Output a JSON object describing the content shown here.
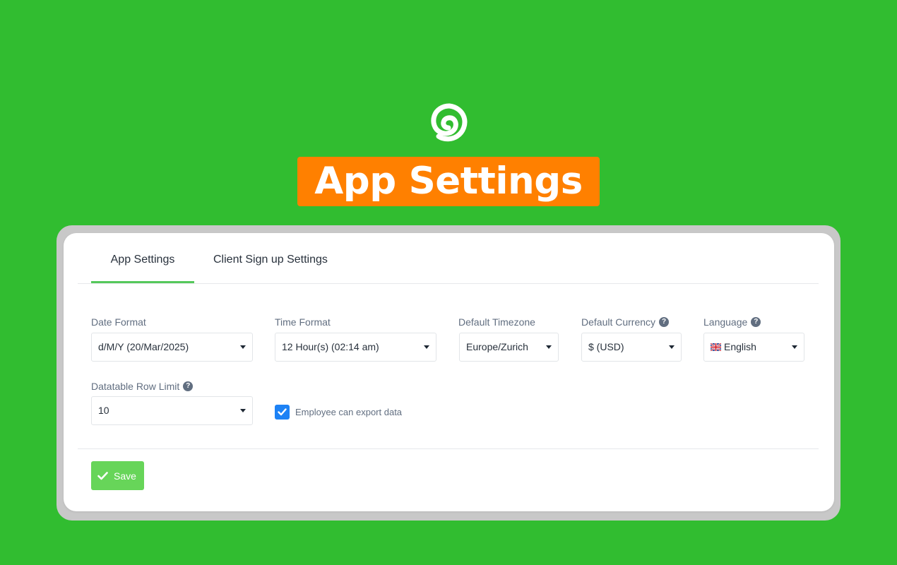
{
  "brand": {
    "logo_icon": "swirl-logo-icon",
    "logo_color": "#ffffff"
  },
  "headline": "App Settings",
  "colors": {
    "background": "#31bd30",
    "headline_bg": "#ff8000",
    "accent": "#55c85b",
    "save_button": "#67d559",
    "checkbox": "#1d82f5"
  },
  "tabs": [
    {
      "label": "App Settings",
      "active": true
    },
    {
      "label": "Client Sign up Settings",
      "active": false
    }
  ],
  "fields": {
    "date_format": {
      "label": "Date Format",
      "value": "d/M/Y (20/Mar/2025)"
    },
    "time_format": {
      "label": "Time Format",
      "value": "12 Hour(s) (02:14 am)"
    },
    "timezone": {
      "label": "Default Timezone",
      "value": "Europe/Zurich"
    },
    "currency": {
      "label": "Default Currency",
      "value": "$ (USD)"
    },
    "language": {
      "label": "Language",
      "value": "English",
      "flag_icon": "uk-flag-icon"
    },
    "row_limit": {
      "label": "Datatable Row Limit",
      "value": "10"
    }
  },
  "help_icon": "?",
  "export_checkbox": {
    "label": "Employee can export data",
    "checked": true
  },
  "save_button": {
    "label": "Save",
    "icon": "check-icon"
  }
}
